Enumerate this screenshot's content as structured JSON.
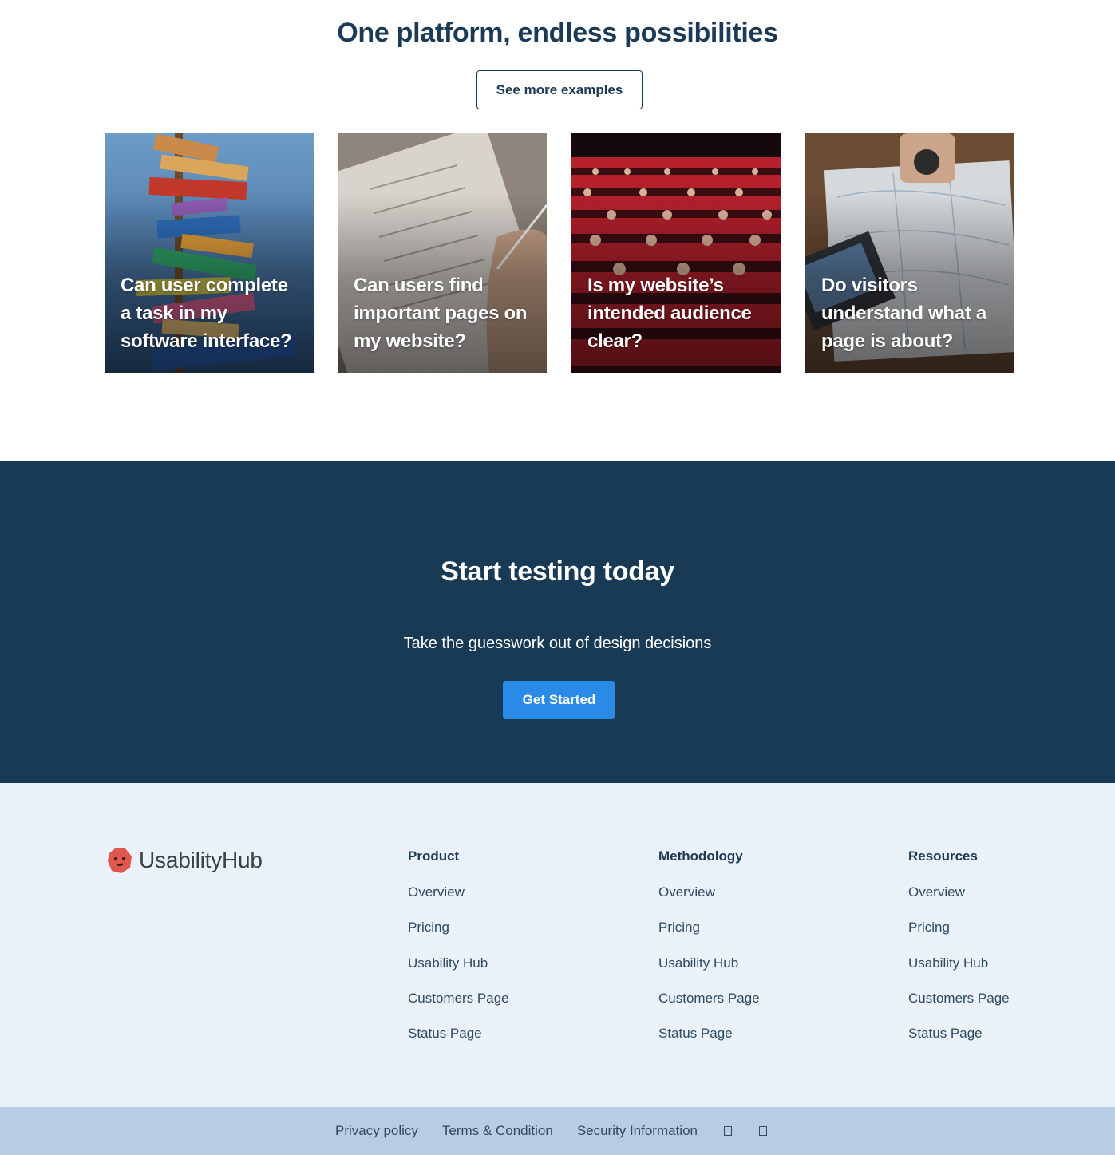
{
  "examples": {
    "title": "One platform, endless possibilities",
    "see_more_label": "See more examples",
    "cards": [
      {
        "caption": "Can user complete a task in my software interface?",
        "image": "signpost-photo"
      },
      {
        "caption": "Can users find important pages on my website?",
        "image": "notebook-checklist-photo"
      },
      {
        "caption": "Is my website’s intended audience clear?",
        "image": "theater-audience-photo"
      },
      {
        "caption": "Do visitors understand what a page is about?",
        "image": "map-and-laptop-photo"
      }
    ]
  },
  "cta": {
    "title": "Start testing today",
    "subtitle": "Take the guesswork out of design decisions",
    "button_label": "Get Started"
  },
  "footer": {
    "brand": "UsabilityHub",
    "columns": [
      {
        "title": "Product",
        "links": [
          "Overview",
          "Pricing",
          "Usability Hub",
          "Customers Page",
          "Status Page"
        ]
      },
      {
        "title": "Methodology",
        "links": [
          "Overview",
          "Pricing",
          "Usability Hub",
          "Customers Page",
          "Status Page"
        ]
      },
      {
        "title": "Resources",
        "links": [
          "Overview",
          "Pricing",
          "Usability Hub",
          "Customers Page",
          "Status Page"
        ]
      }
    ],
    "bottom_links": [
      "Privacy policy",
      "Terms & Condition",
      "Security Information"
    ],
    "social_icons": [
      "social-icon",
      "social-icon"
    ]
  },
  "colors": {
    "navy": "#183a54",
    "heading": "#1a3a56",
    "primary_button": "#2a8ae8",
    "footer_bg": "#eaf1f9",
    "bottom_bar_bg": "#b8cde3",
    "logo_red": "#e0574f"
  }
}
